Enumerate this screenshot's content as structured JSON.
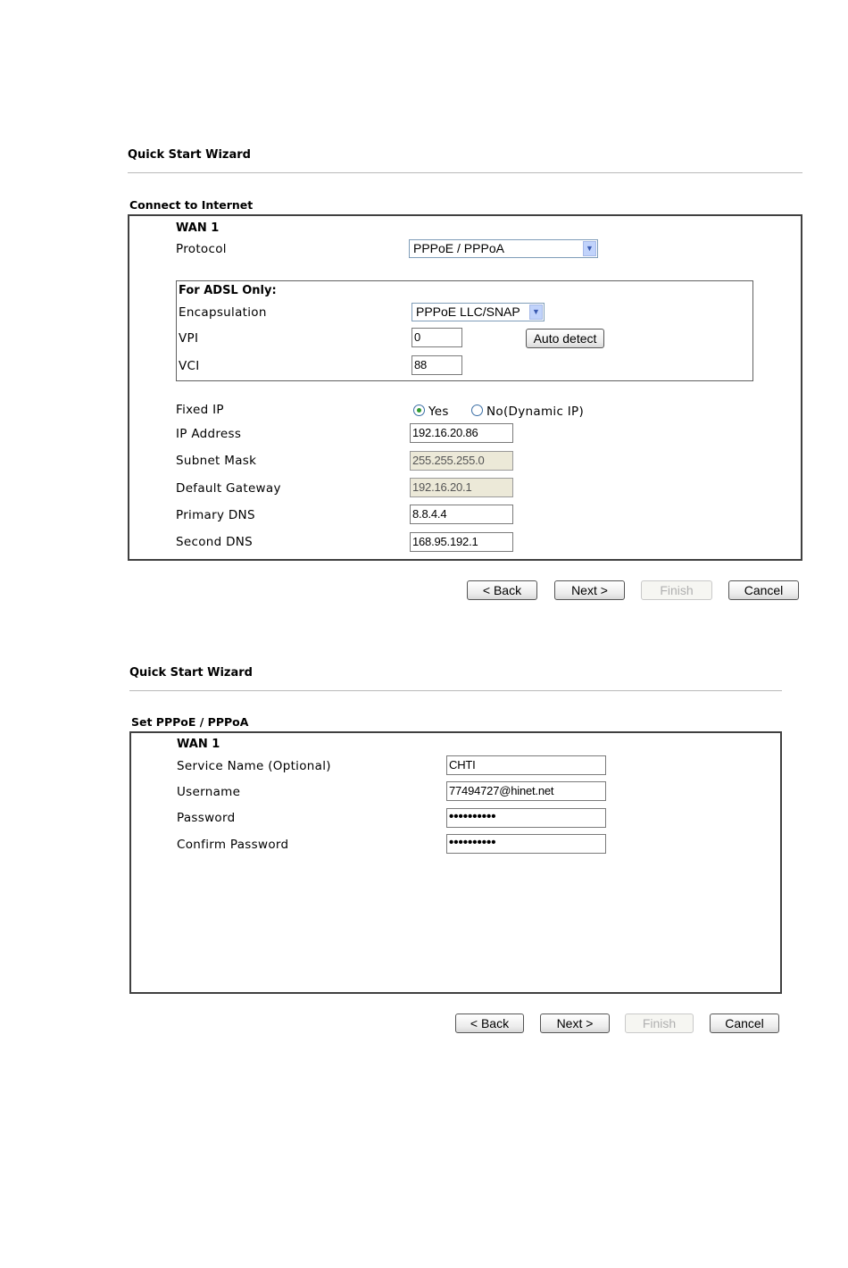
{
  "wizard1": {
    "title": "Quick Start Wizard",
    "section_title": "Connect to Internet",
    "wan_label": "WAN 1",
    "protocol": {
      "label": "Protocol",
      "value": "PPPoE / PPPoA"
    },
    "adsl": {
      "title": "For ADSL Only:",
      "encapsulation": {
        "label": "Encapsulation",
        "value": "PPPoE LLC/SNAP"
      },
      "vpi": {
        "label": "VPI",
        "value": "0"
      },
      "vci": {
        "label": "VCI",
        "value": "88"
      },
      "auto_detect_label": "Auto detect"
    },
    "fixed_ip": {
      "label": "Fixed IP",
      "yes_label": "Yes",
      "no_label": "No(Dynamic IP)",
      "selected": "Yes"
    },
    "ip_address": {
      "label": "IP Address",
      "value": "192.16.20.86"
    },
    "subnet_mask": {
      "label": "Subnet Mask",
      "value": "255.255.255.0"
    },
    "default_gateway": {
      "label": "Default Gateway",
      "value": "192.16.20.1"
    },
    "primary_dns": {
      "label": "Primary DNS",
      "value": "8.8.4.4"
    },
    "second_dns": {
      "label": "Second DNS",
      "value": "168.95.192.1"
    },
    "buttons": {
      "back": "< Back",
      "next": "Next >",
      "finish": "Finish",
      "cancel": "Cancel"
    }
  },
  "wizard2": {
    "title": "Quick Start Wizard",
    "section_title": "Set PPPoE / PPPoA",
    "wan_label": "WAN 1",
    "service_name": {
      "label": "Service Name (Optional)",
      "value": "CHTI"
    },
    "username": {
      "label": "Username",
      "value": "77494727@hinet.net"
    },
    "password": {
      "label": "Password",
      "value": "••••••••••"
    },
    "confirm_password": {
      "label": "Confirm Password",
      "value": "••••••••••"
    },
    "buttons": {
      "back": "< Back",
      "next": "Next >",
      "finish": "Finish",
      "cancel": "Cancel"
    }
  },
  "colors": {
    "frame": "#404040",
    "disabled_field": "#ece9d8",
    "radio_dot": "#2f9a2f",
    "select_arrow": "#c1d3fb"
  }
}
